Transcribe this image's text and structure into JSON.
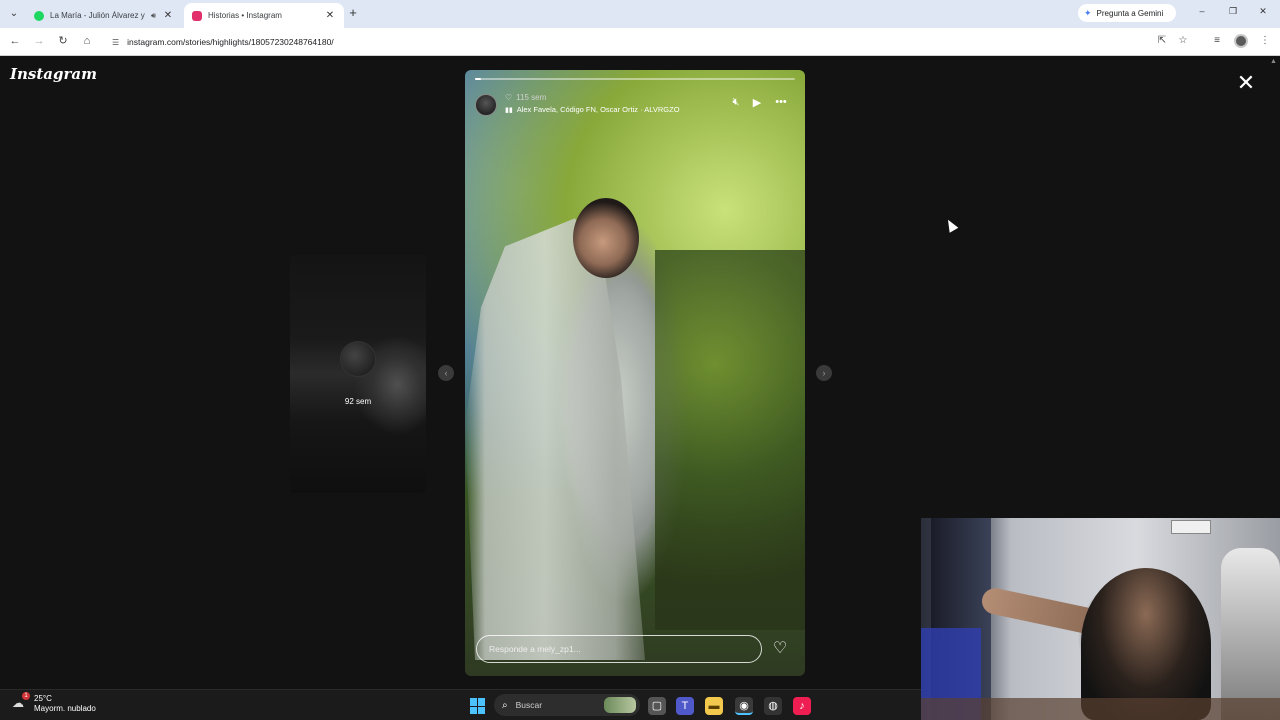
{
  "browser": {
    "tabs": [
      {
        "title": "La María - Julión Álvarez y",
        "active": false,
        "favicon_color": "#1ed760",
        "audio": true
      },
      {
        "title": "Historias • Instagram",
        "active": true,
        "favicon_color": "#e1306c"
      }
    ],
    "new_tab_label": "+",
    "gemini_label": "Pregunta a Gemini",
    "url": "instagram.com/stories/highlights/18057230248764180/"
  },
  "page": {
    "logo": "Instagram",
    "close_label": "✕",
    "side_story": {
      "time": "92 sem"
    },
    "story": {
      "time": "115 sem",
      "music": "Alex Favela, Código FN, Oscar Ortiz · ALVRGZO",
      "progress": 0.02,
      "reply_placeholder": "Responde a mely_zp1..."
    }
  },
  "taskbar": {
    "temperature": "25°C",
    "weather": "Mayorm. nublado",
    "notification_count": "1",
    "search_placeholder": "Buscar"
  },
  "icons": [
    "tab-list-icon",
    "spotify-icon",
    "speaker-icon",
    "instagram-icon",
    "close-tab-icon",
    "gemini-spark-icon",
    "minimize-icon",
    "restore-icon",
    "close-window-icon",
    "back-icon",
    "forward-icon",
    "reload-icon",
    "home-icon",
    "site-info-icon",
    "install-icon",
    "star-icon",
    "media-icon",
    "menu-icon",
    "mute-icon",
    "play-icon",
    "more-icon",
    "heart-icon",
    "chevron-left-icon",
    "chevron-right-icon",
    "windows-icon",
    "search-icon",
    "task-view-icon",
    "teams-icon",
    "file-explorer-icon",
    "chrome-icon",
    "tiktok-icon"
  ]
}
